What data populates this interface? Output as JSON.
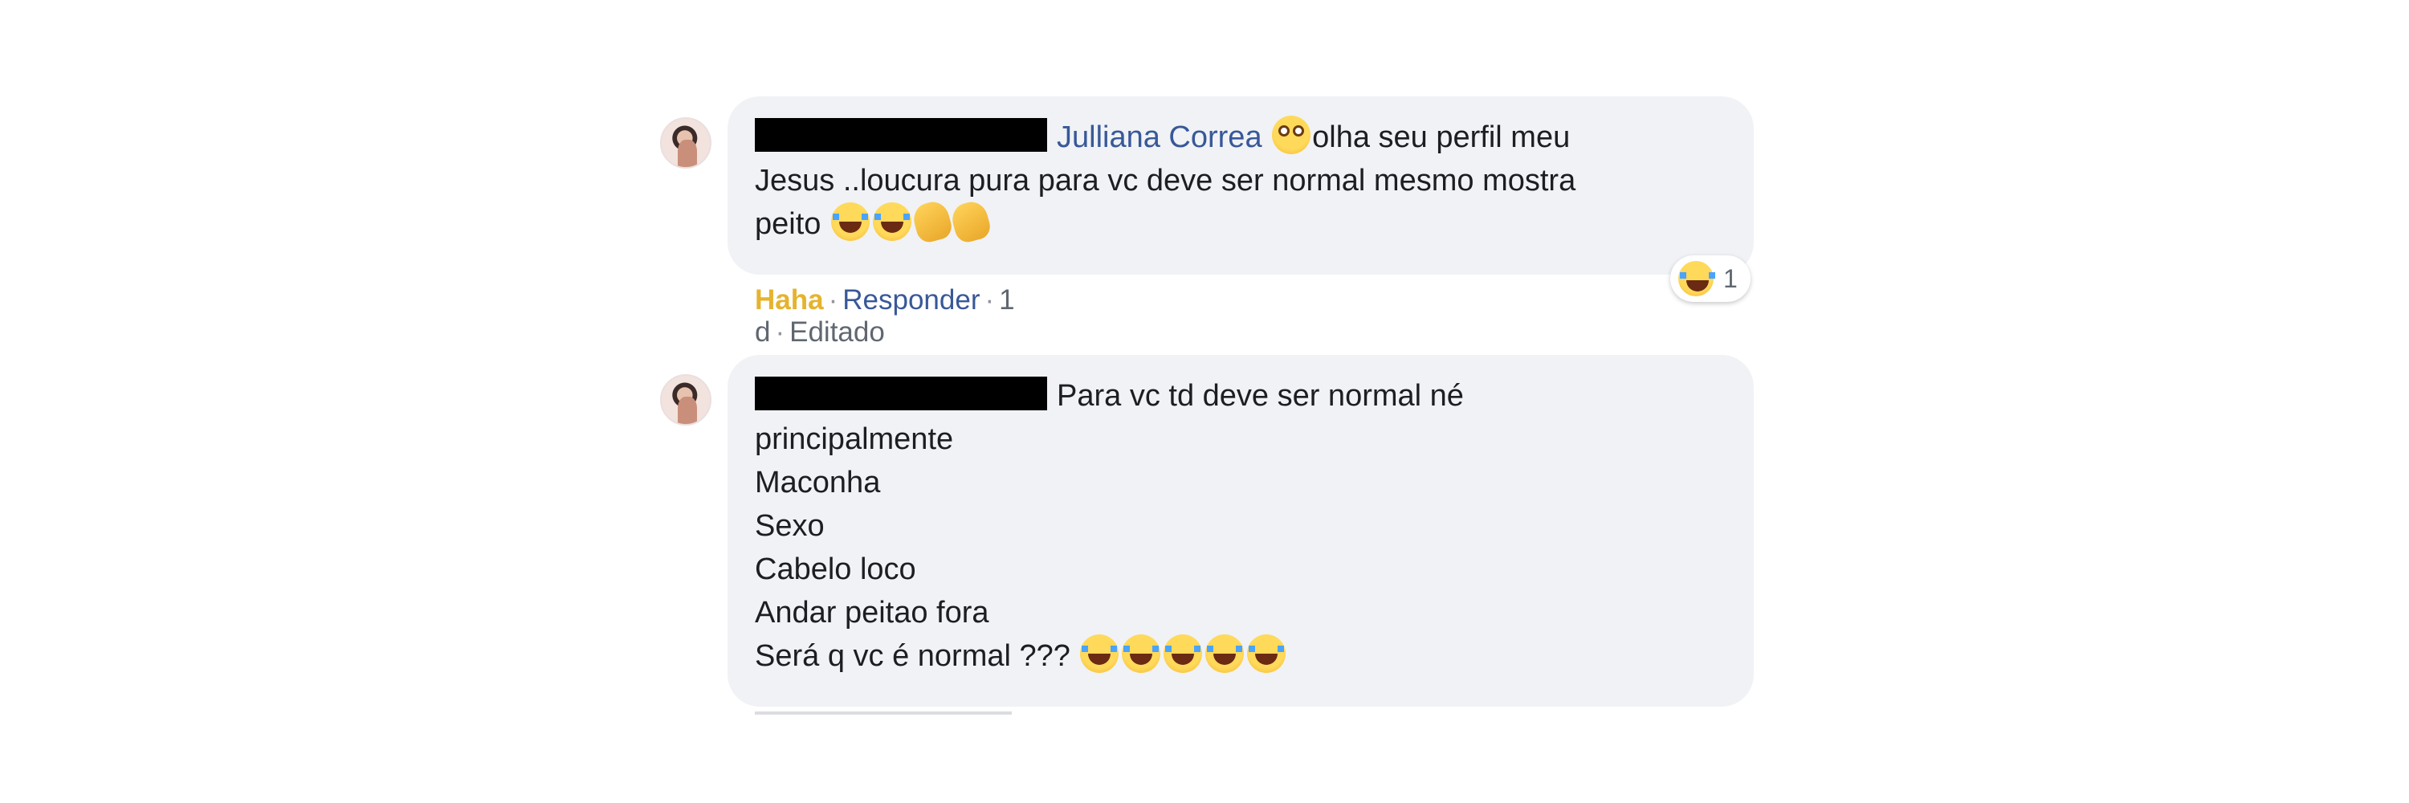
{
  "comments": [
    {
      "author_display": "Julliana Correa",
      "line1_after_mention": "olha seu perfil meu",
      "line2": "Jesus ..loucura pura para vc deve ser normal mesmo mostra",
      "line3": "peito",
      "meta": {
        "reaction_label": "Haha",
        "reply_label": "Responder",
        "time": "1 d",
        "edited": "Editado"
      },
      "reaction_count": "1",
      "reaction_icon": "laughing-emoji"
    },
    {
      "line1": "Para vc td deve ser normal né",
      "lines": [
        "principalmente",
        "Maconha",
        "Sexo",
        "Cabelo loco",
        "Andar peitao fora"
      ],
      "last_line": "Será q vc é normal ???"
    }
  ],
  "colors": {
    "bubble": "#f0f2f5",
    "mention": "#385898",
    "haha": "#e6b32e",
    "meta": "#606770"
  }
}
